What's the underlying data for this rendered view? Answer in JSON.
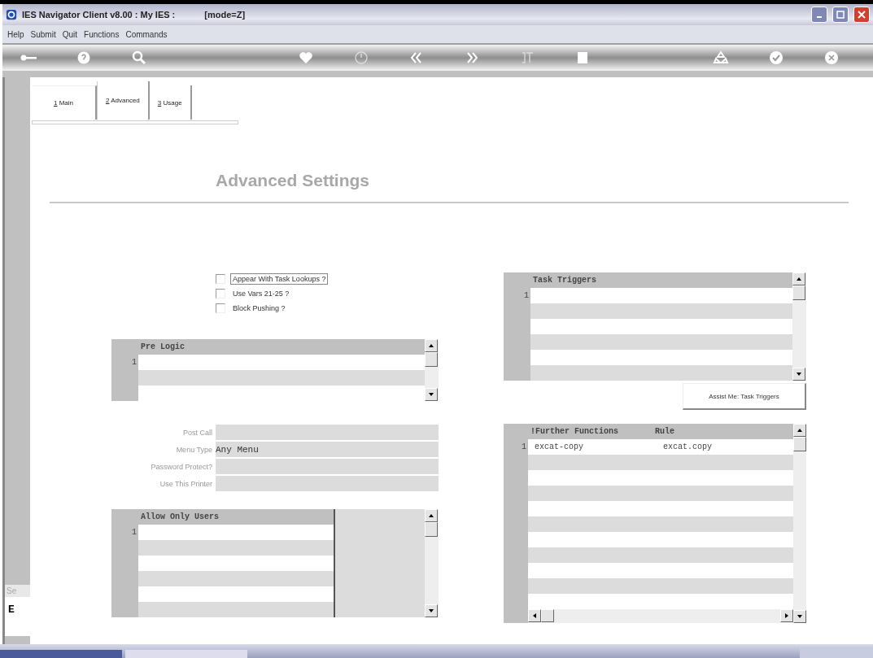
{
  "window": {
    "title": "IES Navigator Client v8.00 : My IES :",
    "mode": "[mode=Z]"
  },
  "menu": [
    "Help",
    "Submit",
    "Quit",
    "Functions",
    "Commands"
  ],
  "tabs": [
    {
      "label": "1 Main",
      "selected": false
    },
    {
      "label": "2 Advanced",
      "selected": true
    },
    {
      "label": "3 Usage",
      "selected": false
    }
  ],
  "heading": "Advanced Settings",
  "checkboxes": [
    {
      "label": "Appear With Task Lookups ?",
      "checked": false,
      "focused": true
    },
    {
      "label": "Use Vars 21-25 ?",
      "checked": false,
      "focused": false
    },
    {
      "label": "Block Pushing ?",
      "checked": false,
      "focused": false
    }
  ],
  "pre_logic": {
    "columns": [
      "Pre Logic"
    ],
    "rows": [
      {
        "number": "1",
        "cells": [
          ""
        ]
      }
    ]
  },
  "fields": [
    {
      "label": "Post Call"
    },
    {
      "label": "Menu Type",
      "value": "Any Menu"
    },
    {
      "label": "Password Protect?"
    },
    {
      "label": "Use This Printer"
    }
  ],
  "allow_only_users": {
    "columns": [
      "Allow Only Users"
    ],
    "rows": [
      {
        "number": "1",
        "cells": [
          ""
        ]
      }
    ]
  },
  "task_triggers": {
    "columns": [
      "Task Triggers"
    ],
    "rows": [
      {
        "number": "1",
        "cells": [
          ""
        ]
      }
    ]
  },
  "assist_button": "Assist Me: Task Triggers",
  "further_functions": {
    "columns": [
      "!Further Functions",
      "Rule"
    ],
    "rows": [
      {
        "number": "1",
        "cells": [
          "excat-copy",
          "excat.copy"
        ]
      }
    ]
  },
  "left_strip": {
    "label": "Se",
    "letter": "E"
  }
}
